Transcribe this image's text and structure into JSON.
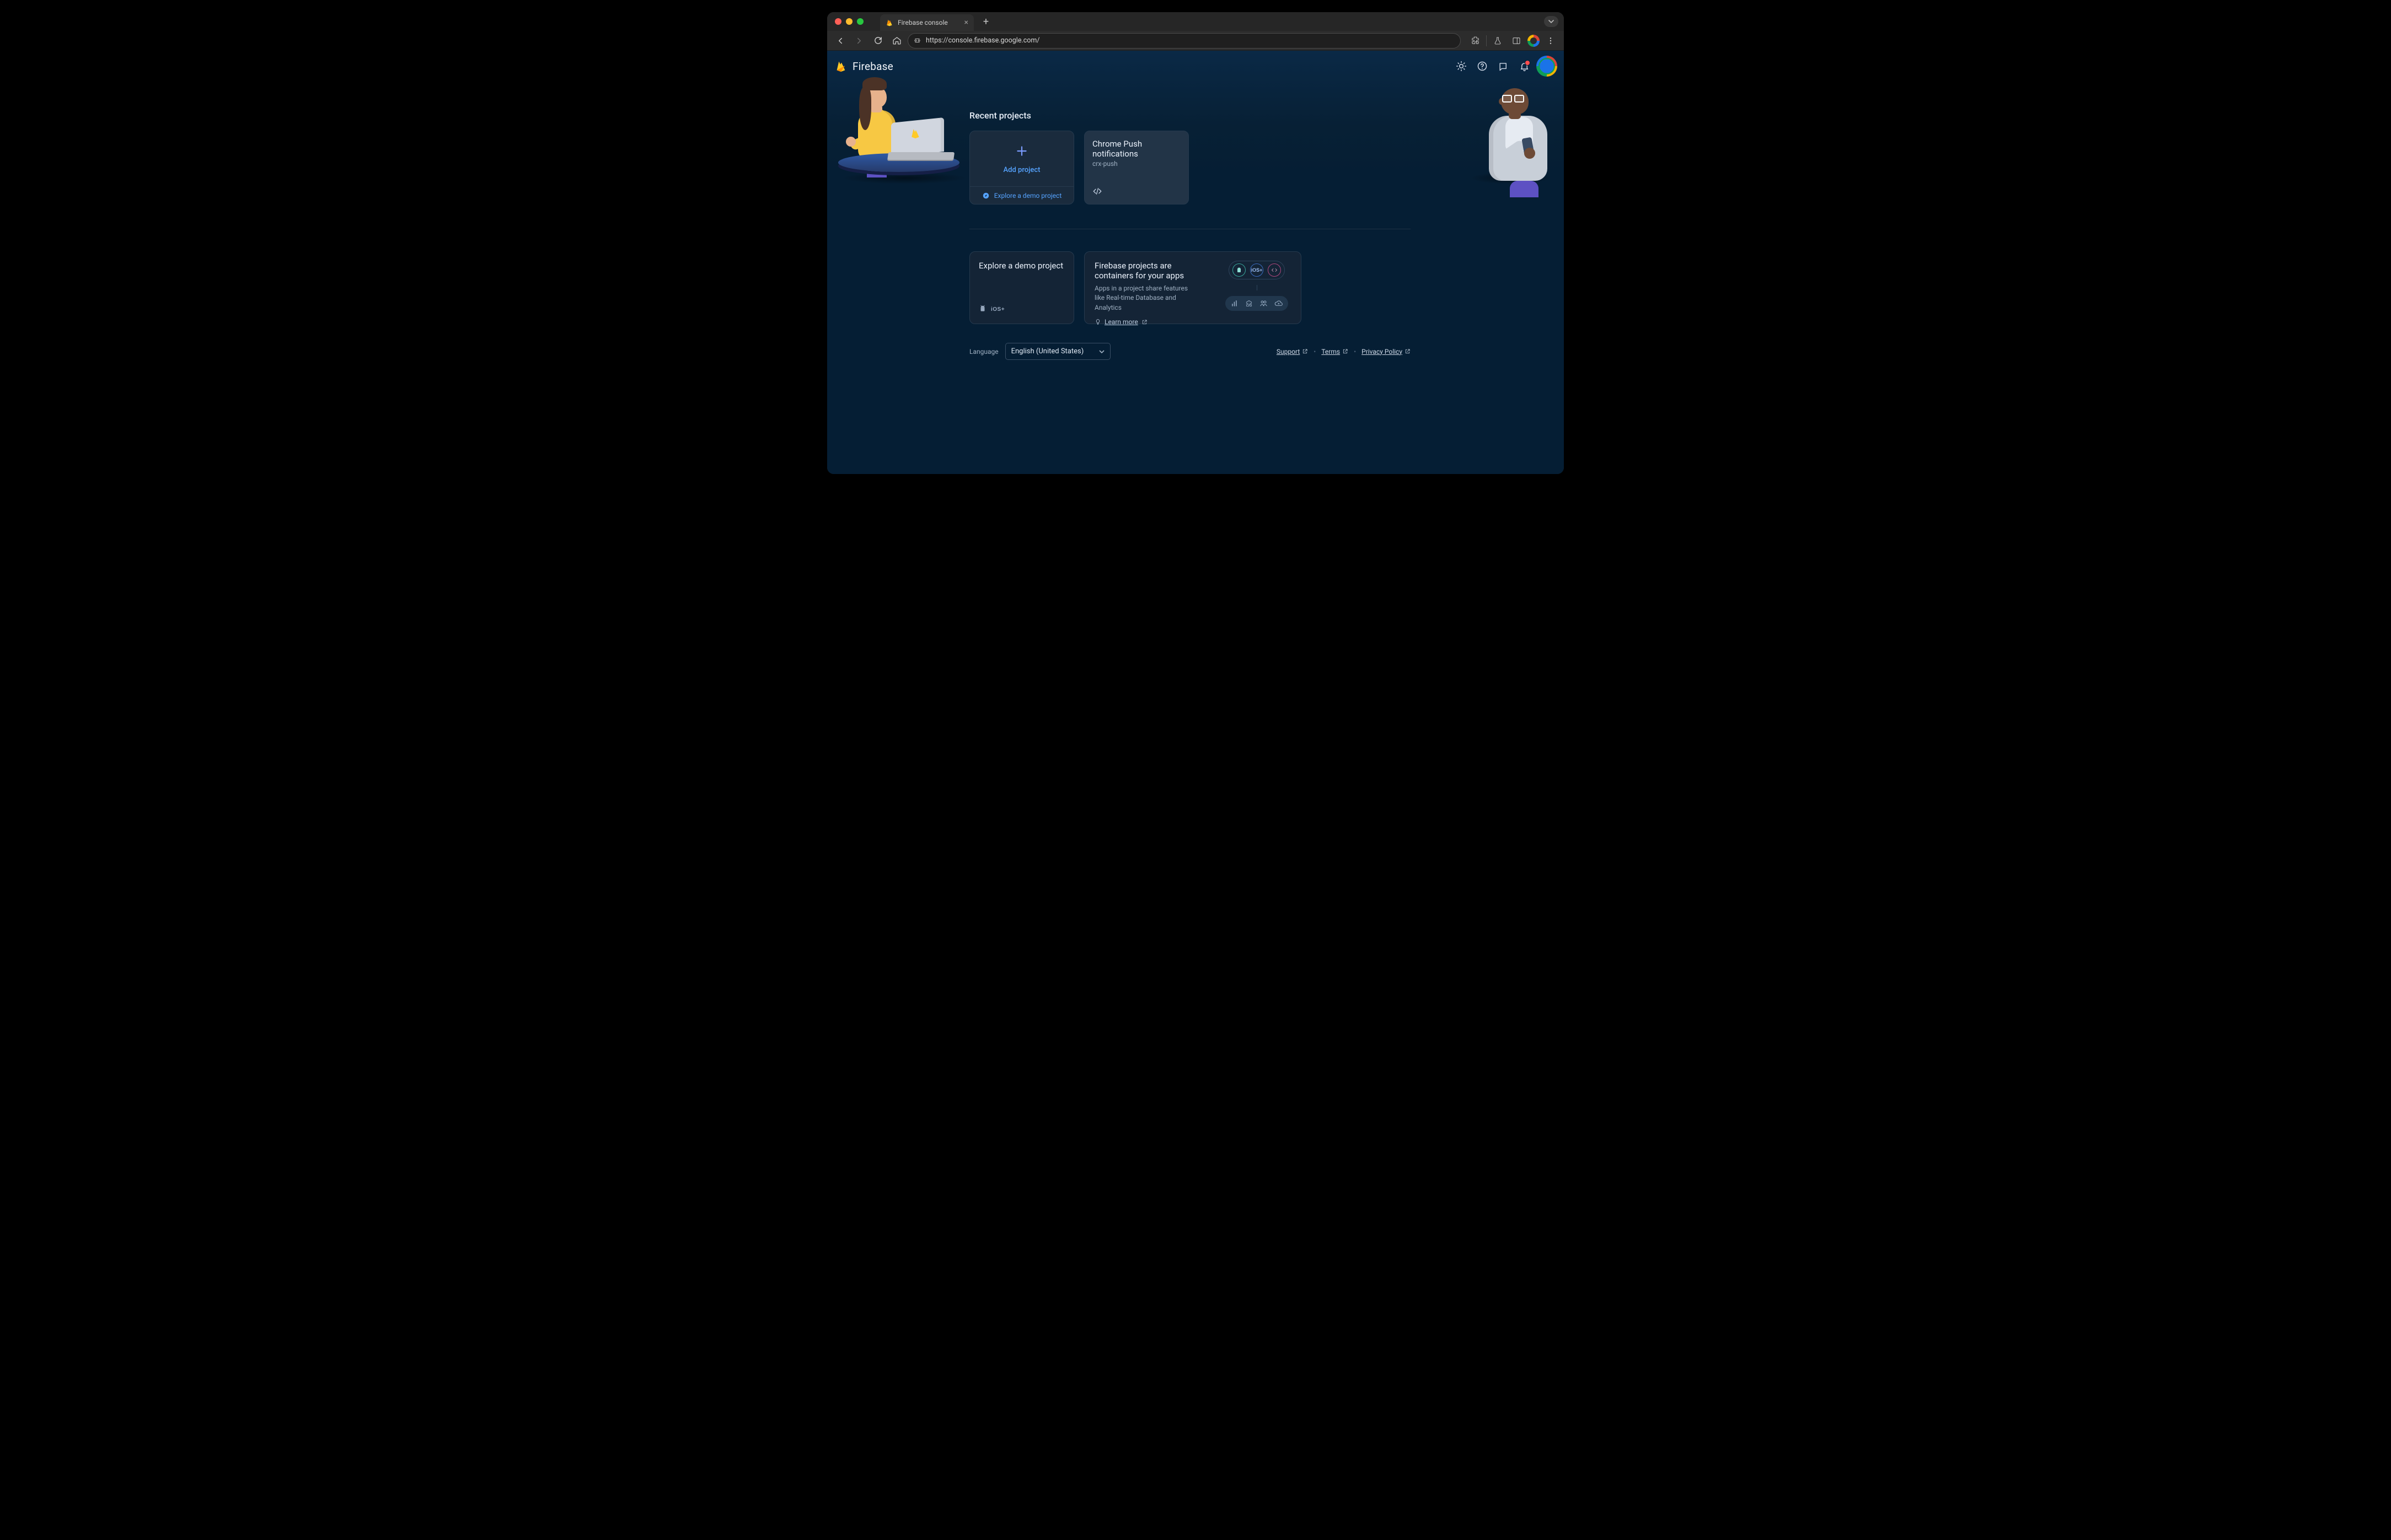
{
  "browser": {
    "tab_title": "Firebase console",
    "url": "https://console.firebase.google.com/"
  },
  "appbar": {
    "brand": "Firebase"
  },
  "sections": {
    "recent_title": "Recent projects",
    "add_project_label": "Add project",
    "explore_demo_label": "Explore a demo project"
  },
  "projects": [
    {
      "title": "Chrome Push notifications",
      "id": "crx-push"
    }
  ],
  "lower": {
    "explore_title": "Explore a demo project",
    "info_title": "Firebase projects are containers for your apps",
    "info_desc": "Apps in a project share features like Real-time Database and Analytics",
    "learn_more": "Learn more"
  },
  "footer": {
    "language_label": "Language",
    "language_value": "English (United States)",
    "links": {
      "support": "Support",
      "terms": "Terms",
      "privacy": "Privacy Policy"
    }
  }
}
